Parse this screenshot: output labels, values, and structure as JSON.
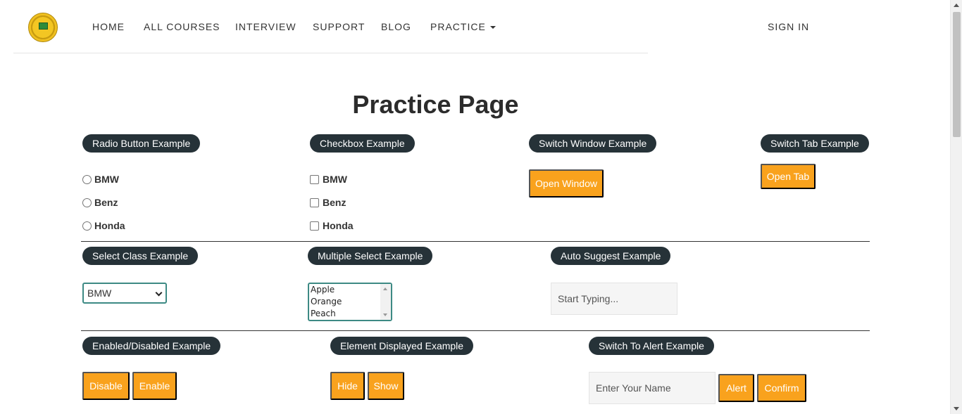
{
  "nav": {
    "items": [
      "HOME",
      "ALL COURSES",
      "INTERVIEW",
      "SUPPORT",
      "BLOG",
      "PRACTICE"
    ],
    "signin": "SIGN IN"
  },
  "page_title": "Practice Page",
  "radio": {
    "legend": "Radio Button Example",
    "options": [
      "BMW",
      "Benz",
      "Honda"
    ]
  },
  "checkbox": {
    "legend": "Checkbox Example",
    "options": [
      "BMW",
      "Benz",
      "Honda"
    ]
  },
  "switch_window": {
    "legend": "Switch Window Example",
    "button": "Open Window"
  },
  "switch_tab": {
    "legend": "Switch Tab Example",
    "button": "Open Tab"
  },
  "select_class": {
    "legend": "Select Class Example",
    "selected": "BMW"
  },
  "multi_select": {
    "legend": "Multiple Select Example",
    "options": [
      "Apple",
      "Orange",
      "Peach"
    ]
  },
  "auto_suggest": {
    "legend": "Auto Suggest Example",
    "placeholder": "Start Typing..."
  },
  "enabled_disabled": {
    "legend": "Enabled/Disabled Example",
    "disable": "Disable",
    "enable": "Enable"
  },
  "element_displayed": {
    "legend": "Element Displayed Example",
    "hide": "Hide",
    "show": "Show"
  },
  "alert": {
    "legend": "Switch To Alert Example",
    "placeholder": "Enter Your Name",
    "alert": "Alert",
    "confirm": "Confirm"
  },
  "colors": {
    "accent": "#f9a21d",
    "legend_bg": "#263238",
    "select_border": "#3d8a84"
  }
}
